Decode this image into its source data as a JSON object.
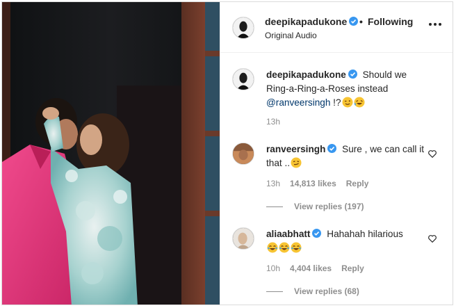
{
  "header": {
    "username": "deepikapadukone",
    "separator": "•",
    "follow_status": "Following",
    "subtitle": "Original Audio"
  },
  "caption": {
    "username": "deepikapadukone",
    "text": "Should we Ring-a-Ring-a-Roses instead",
    "mention": "@ranveersingh",
    "suffix": " !?",
    "emojis": [
      "winking-face",
      "rolling-laughing-face"
    ],
    "time": "13h"
  },
  "comments": [
    {
      "username": "ranveersingh",
      "text": "Sure , we can call it that ..",
      "emojis": [
        "smirking-face"
      ],
      "time": "13h",
      "likes": "14,813 likes",
      "reply_label": "Reply",
      "view_replies": "View replies (197)"
    },
    {
      "username": "aliaabhatt",
      "text": "Hahahah hilarious",
      "emojis": [
        "tears-of-joy-face",
        "tears-of-joy-face",
        "tears-of-joy-face"
      ],
      "time": "10h",
      "likes": "4,404 likes",
      "reply_label": "Reply",
      "view_replies": "View replies (68)"
    }
  ],
  "icons": {
    "verified": "verified-badge-icon",
    "more": "more-options-icon",
    "like": "heart-icon"
  },
  "colors": {
    "verified_blue": "#3897f0",
    "mention_blue": "#00376b",
    "muted": "#8e8e8e",
    "hoodie_pink": "#e4327a"
  }
}
